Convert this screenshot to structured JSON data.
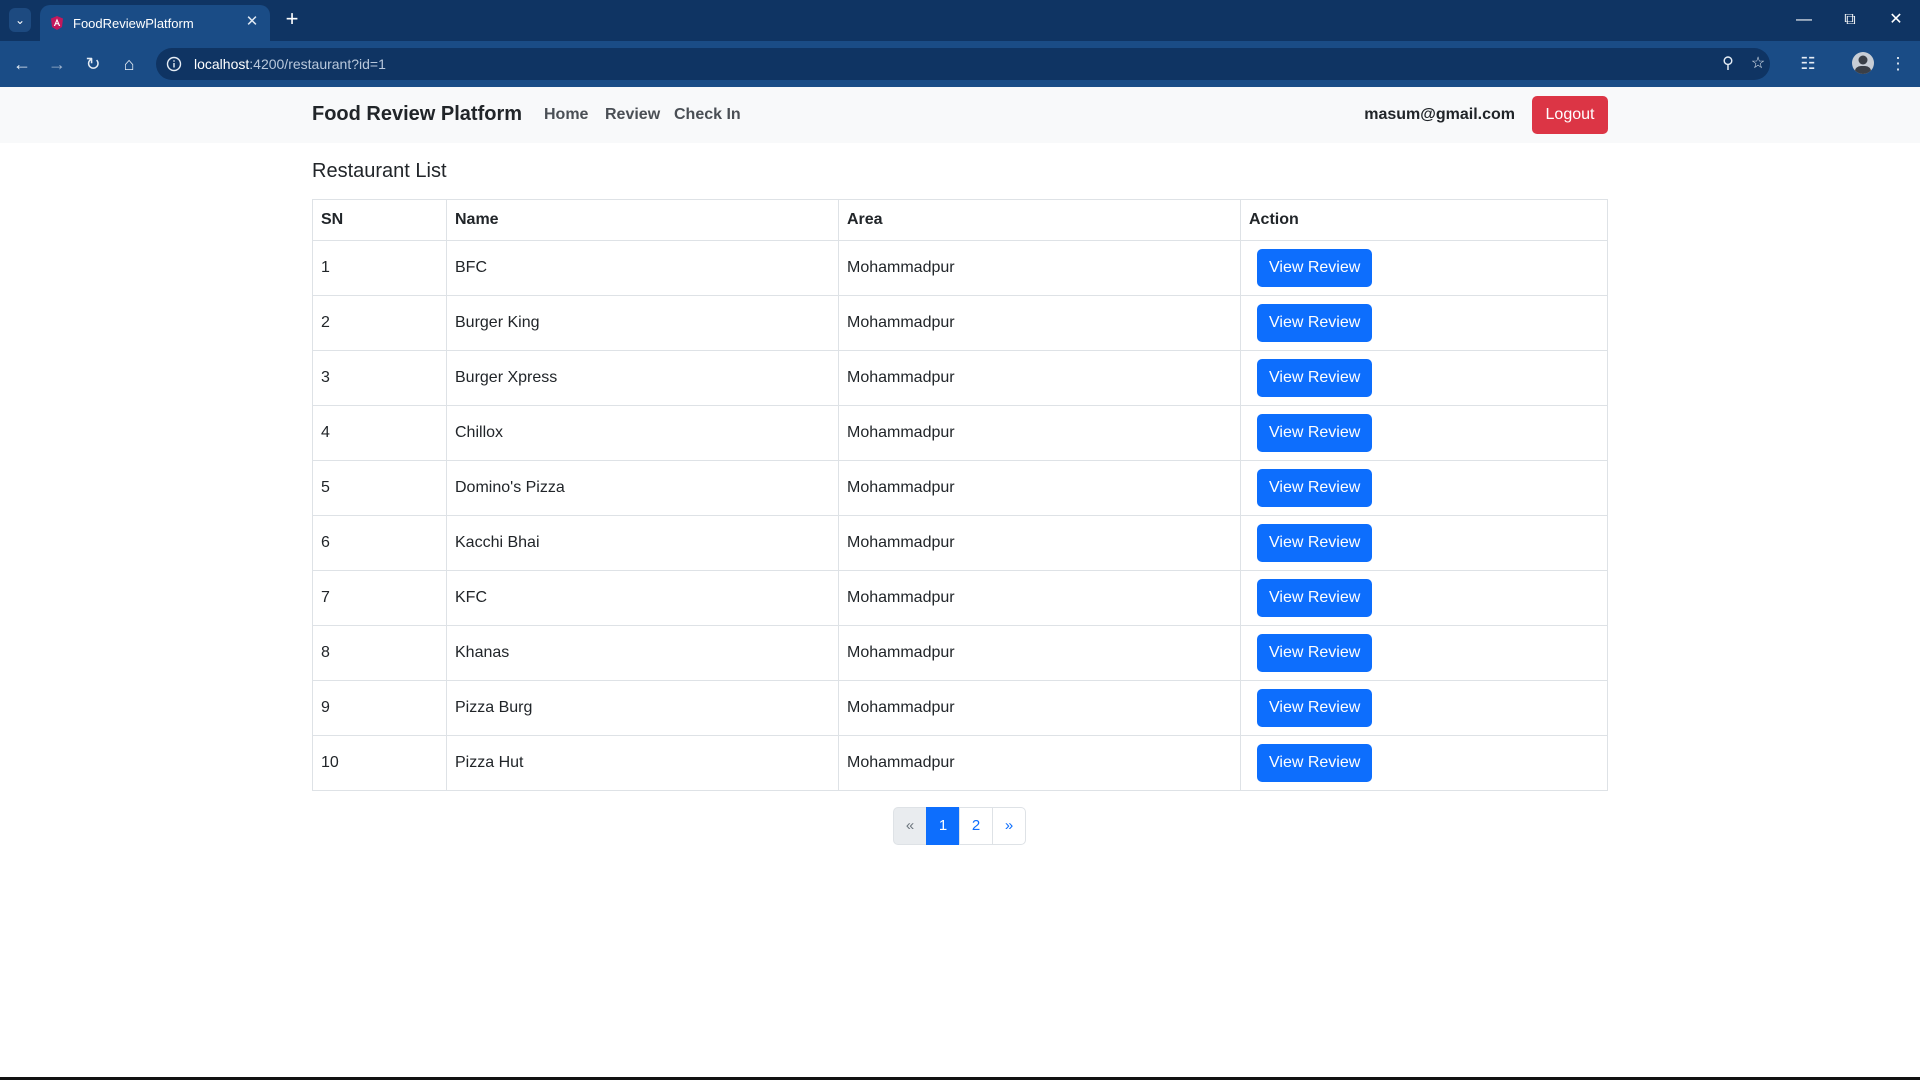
{
  "browser": {
    "tab_title": "FoodReviewPlatform",
    "url_host": "localhost",
    "url_path": ":4200/restaurant?id=1"
  },
  "navbar": {
    "brand": "Food Review Platform",
    "links": [
      "Home",
      "Review",
      "Check In"
    ],
    "user_email": "masum@gmail.com",
    "logout_label": "Logout"
  },
  "page": {
    "title": "Restaurant List"
  },
  "table": {
    "columns": [
      "SN",
      "Name",
      "Area",
      "Action"
    ],
    "action_label": "View Review",
    "rows": [
      {
        "sn": "1",
        "name": "BFC",
        "area": "Mohammadpur"
      },
      {
        "sn": "2",
        "name": "Burger King",
        "area": "Mohammadpur"
      },
      {
        "sn": "3",
        "name": "Burger Xpress",
        "area": "Mohammadpur"
      },
      {
        "sn": "4",
        "name": "Chillox",
        "area": "Mohammadpur"
      },
      {
        "sn": "5",
        "name": "Domino's Pizza",
        "area": "Mohammadpur"
      },
      {
        "sn": "6",
        "name": "Kacchi Bhai",
        "area": "Mohammadpur"
      },
      {
        "sn": "7",
        "name": "KFC",
        "area": "Mohammadpur"
      },
      {
        "sn": "8",
        "name": "Khanas",
        "area": "Mohammadpur"
      },
      {
        "sn": "9",
        "name": "Pizza Burg",
        "area": "Mohammadpur"
      },
      {
        "sn": "10",
        "name": "Pizza Hut",
        "area": "Mohammadpur"
      }
    ]
  },
  "pagination": {
    "prev": "«",
    "pages": [
      "1",
      "2"
    ],
    "active_page": "1",
    "next": "»"
  },
  "colors": {
    "primary": "#0d6efd",
    "danger": "#dc3545",
    "navbar_bg": "#f8f9fa",
    "chrome_dark": "#0f3463",
    "chrome_light": "#1a4c86"
  }
}
